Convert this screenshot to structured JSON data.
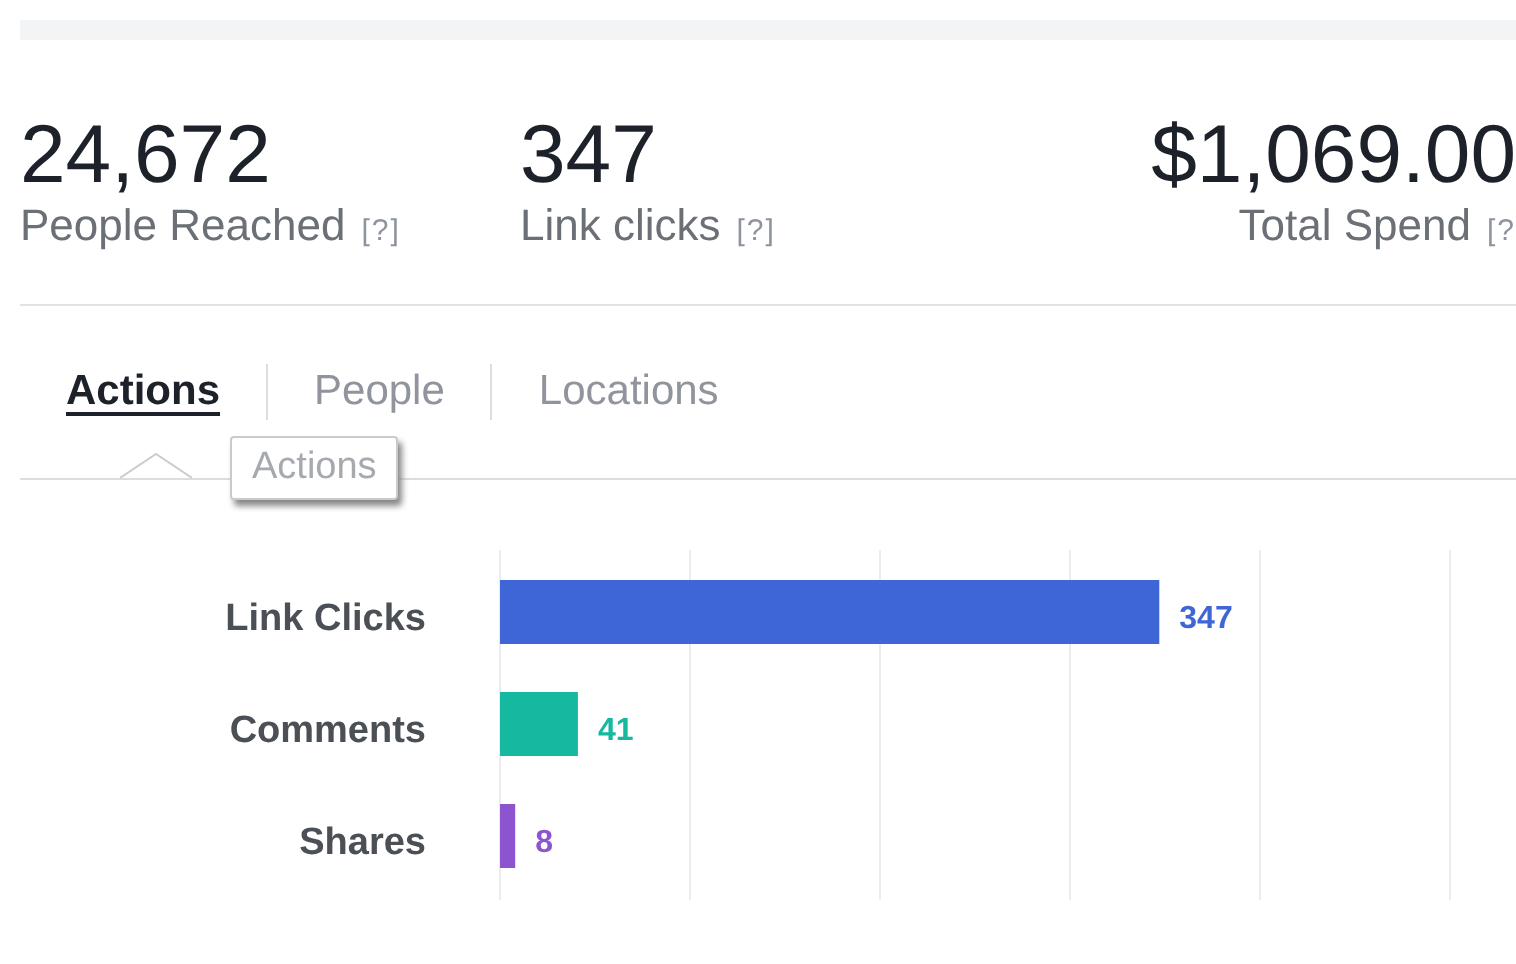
{
  "stats": [
    {
      "value": "24,672",
      "label": "People Reached",
      "help": "[?]"
    },
    {
      "value": "347",
      "label": "Link clicks",
      "help": "[?]"
    },
    {
      "value": "$1,069.00",
      "label": "Total Spend",
      "help": "[?"
    }
  ],
  "tabs": [
    {
      "label": "Actions",
      "selected": true
    },
    {
      "label": "People",
      "selected": false
    },
    {
      "label": "Locations",
      "selected": false
    }
  ],
  "tooltip": "Actions",
  "chart_data": {
    "type": "bar",
    "orientation": "horizontal",
    "stacked": true,
    "categories": [
      "Link Clicks",
      "Comments",
      "Shares"
    ],
    "xlim": [
      0,
      500
    ],
    "data_labels": true,
    "series": [
      {
        "color": "#3e66d6",
        "values": [
          347,
          null,
          null
        ]
      },
      {
        "color": "#16b9a0",
        "values": [
          null,
          41,
          null
        ]
      },
      {
        "color": "#8c55cf",
        "values": [
          null,
          null,
          8
        ]
      }
    ]
  }
}
